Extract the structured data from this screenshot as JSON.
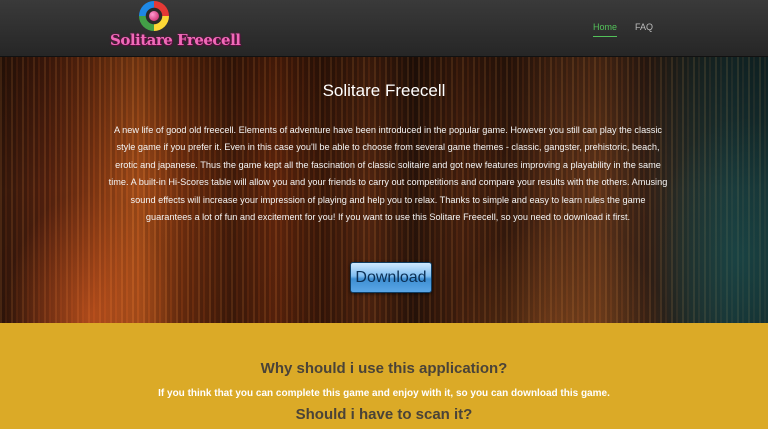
{
  "header": {
    "logo_text": "Solitare Freecell",
    "nav": [
      {
        "label": "Home",
        "active": true
      },
      {
        "label": "FAQ",
        "active": false
      }
    ]
  },
  "hero": {
    "title": "Solitare Freecell",
    "description": "A new life of good old freecell. Elements of adventure have been introduced in the popular game. However you still can play the classic style game if you prefer it. Even in this case you'll be able to choose from several game themes - classic, gangster, prehistoric, beach, erotic and japanese. Thus the game kept all the fascination of classic solitaire and got new features improving a playability in the same time. A built-in Hi-Scores table will allow you and your friends to carry out competitions and compare your results with the others. Amusing sound effects will increase your impression of playing and help you to relax. Thanks to simple and easy to learn rules the game guarantees a lot of fun and excitement for you! If you want to use this Solitare Freecell, so you need to download it first.",
    "download_label": "Download"
  },
  "info": {
    "heading": "Why should i use this application?",
    "text": "If you think that you can complete this game and enjoy with it, so you can download this game.",
    "subheading": "Should i have to scan it?"
  },
  "colors": {
    "nav_active": "#53c25a",
    "logo_text": "#f06ab8",
    "info_background": "#dbaa27",
    "download_button": "#5aa6e6"
  }
}
